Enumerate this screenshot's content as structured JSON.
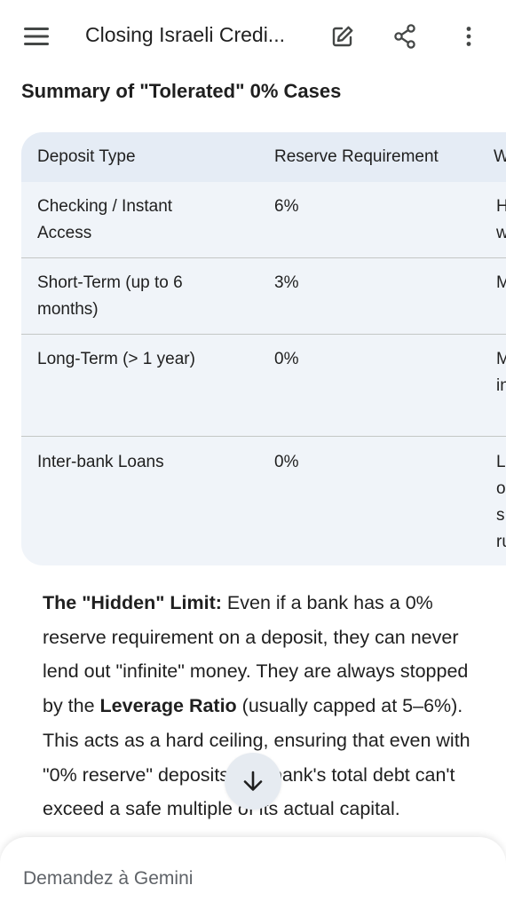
{
  "header": {
    "title": "Closing Israeli Credi...",
    "icons": [
      "menu-icon",
      "edit-icon",
      "share-icon",
      "more-vert-icon"
    ]
  },
  "content": {
    "heading": "Summary of \"Tolerated\" 0% Cases",
    "table": {
      "headers": [
        "Deposit Type",
        "Reserve Requirement",
        "W"
      ],
      "rows": [
        {
          "type_line1": "Checking / Instant",
          "type_line2": "Access",
          "reserve": "6%",
          "third_line1": "H",
          "third_line2": "w",
          "third_line3": "",
          "third_line4": ""
        },
        {
          "type_line1": "Short-Term (up to 6",
          "type_line2": "months)",
          "reserve": "3%",
          "third_line1": "M",
          "third_line2": "",
          "third_line3": "",
          "third_line4": ""
        },
        {
          "type_line1": "Long-Term (> 1 year)",
          "type_line2": "",
          "reserve": "0%",
          "third_line1": "M",
          "third_line2": "in",
          "third_line3": "",
          "third_line4": ""
        },
        {
          "type_line1": "Inter-bank Loans",
          "type_line2": "",
          "reserve": "0%",
          "third_line1": "L",
          "third_line2": "o",
          "third_line3": "s",
          "third_line4": "ru"
        }
      ]
    },
    "paragraph": {
      "bold_lead": "The \"Hidden\" Limit:",
      "text1": " Even if a bank has a 0% reserve requirement on a deposit, they can never lend out \"infinite\" money. They are always stopped by the ",
      "bold_mid": "Leverage Ratio",
      "text2": " (usually capped at 5–6%). This acts as a hard ceiling, ensuring that even with \"0% reserve\" deposits, the bank's total debt can't exceed a safe multiple of its actual capital."
    }
  },
  "input": {
    "placeholder": "Demandez à Gemini"
  },
  "colors": {
    "table_bg": "#f0f4f9",
    "table_header_bg": "#e5ecf5",
    "divider": "#c4c7c5",
    "fab_bg": "#e6ebf1",
    "text": "#1f1f1f",
    "placeholder": "#5f6368"
  }
}
